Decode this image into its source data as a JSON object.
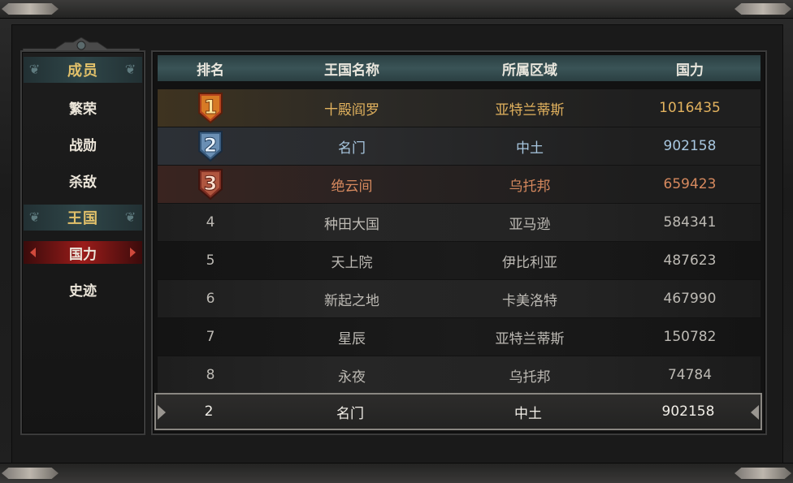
{
  "sidebar": {
    "groups": [
      {
        "header": "成员",
        "items": [
          "繁荣",
          "战勋",
          "杀敌"
        ]
      },
      {
        "header": "王国",
        "items": [
          "国力",
          "史迹"
        ]
      }
    ],
    "active_item": "国力"
  },
  "table": {
    "headers": {
      "rank": "排名",
      "name": "王国名称",
      "region": "所属区域",
      "power": "国力"
    },
    "rows": [
      {
        "rank": "1",
        "name": "十殿阎罗",
        "region": "亚特兰蒂斯",
        "power": "1016435"
      },
      {
        "rank": "2",
        "name": "名门",
        "region": "中土",
        "power": "902158"
      },
      {
        "rank": "3",
        "name": "绝云间",
        "region": "乌托邦",
        "power": "659423"
      },
      {
        "rank": "4",
        "name": "种田大国",
        "region": "亚马逊",
        "power": "584341"
      },
      {
        "rank": "5",
        "name": "天上院",
        "region": "伊比利亚",
        "power": "487623"
      },
      {
        "rank": "6",
        "name": "新起之地",
        "region": "卡美洛特",
        "power": "467990"
      },
      {
        "rank": "7",
        "name": "星辰",
        "region": "亚特兰蒂斯",
        "power": "150782"
      },
      {
        "rank": "8",
        "name": "永夜",
        "region": "乌托邦",
        "power": "74784"
      }
    ],
    "my_row": {
      "rank": "2",
      "name": "名门",
      "region": "中土",
      "power": "902158"
    }
  },
  "colors": {
    "gold": "#e2b25e",
    "silver": "#a8c7e0",
    "bronze": "#d6895e",
    "accent_red": "#9b1c1a",
    "header_teal": "#3a5457"
  },
  "icons": {
    "rank1": "gold-medal-1-icon",
    "rank2": "silver-medal-2-icon",
    "rank3": "bronze-medal-3-icon"
  }
}
